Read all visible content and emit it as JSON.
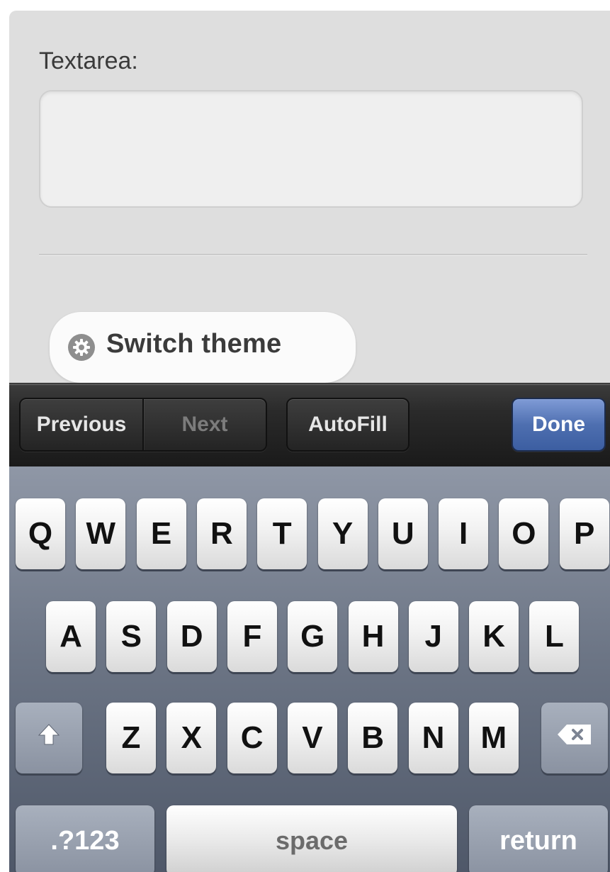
{
  "form": {
    "textarea_label": "Textarea:",
    "textarea_value": "",
    "switch_theme_label": "Switch theme"
  },
  "accessory": {
    "previous_label": "Previous",
    "next_label": "Next",
    "autofill_label": "AutoFill",
    "done_label": "Done"
  },
  "keyboard": {
    "row1": [
      "Q",
      "W",
      "E",
      "R",
      "T",
      "Y",
      "U",
      "I",
      "O",
      "P"
    ],
    "row2": [
      "A",
      "S",
      "D",
      "F",
      "G",
      "H",
      "J",
      "K",
      "L"
    ],
    "row3": [
      "Z",
      "X",
      "C",
      "V",
      "B",
      "N",
      "M"
    ],
    "numbers_label": ".?123",
    "space_label": "space",
    "return_label": "return"
  },
  "icons": {
    "theme": "gear-icon",
    "shift": "shift-arrow-icon",
    "backspace": "backspace-icon"
  },
  "colors": {
    "done_button": "#4e6fb0",
    "keyboard_bg": "#6d7686",
    "page_bg": "#dedede"
  }
}
